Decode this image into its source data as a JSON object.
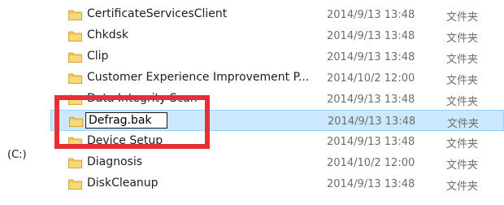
{
  "nav": {
    "drive_label": "(C:)"
  },
  "rows": [
    {
      "name": "CertificateServicesClient",
      "date": "2014/9/13 13:48",
      "type": "文件夹",
      "icon": "folder-icon"
    },
    {
      "name": "Chkdsk",
      "date": "2014/9/13 13:48",
      "type": "文件夹",
      "icon": "folder-icon"
    },
    {
      "name": "Clip",
      "date": "2014/9/13 13:48",
      "type": "文件夹",
      "icon": "folder-icon"
    },
    {
      "name": "Customer Experience Improvement P...",
      "date": "2014/10/2 12:00",
      "type": "文件夹",
      "icon": "folder-icon"
    },
    {
      "name": "Data Integrity Scan",
      "date": "2014/9/13 13:48",
      "type": "文件夹",
      "icon": "folder-icon"
    },
    {
      "name": "Defrag.bak",
      "date": "2014/9/13 13:48",
      "type": "文件夹",
      "icon": "folder-icon",
      "renaming": true
    },
    {
      "name": "Device Setup",
      "date": "2014/9/13 13:48",
      "type": "文件夹",
      "icon": "folder-icon"
    },
    {
      "name": "Diagnosis",
      "date": "2014/10/2 12:00",
      "type": "文件夹",
      "icon": "folder-icon"
    },
    {
      "name": "DiskCleanup",
      "date": "2014/9/13 13:48",
      "type": "文件夹",
      "icon": "folder-icon"
    }
  ],
  "colors": {
    "selection_bg": "#cce8ff",
    "selection_border": "#99d1ff",
    "highlight_border": "#e53035",
    "folder": "#f2c55c"
  }
}
